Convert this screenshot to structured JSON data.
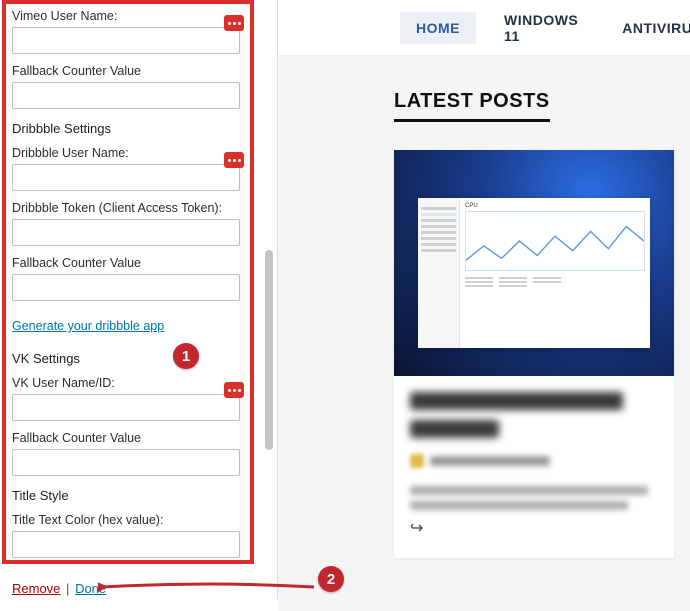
{
  "sidebar": {
    "vimeo": {
      "user_label": "Vimeo User Name:"
    },
    "fallback_label": "Fallback Counter Value",
    "dribbble": {
      "section": "Dribbble Settings",
      "user_label": "Dribbble User Name:",
      "token_label": "Dribbble Token (Client Access Token):",
      "gen_link": "Generate your dribbble app"
    },
    "vk": {
      "section": "VK Settings",
      "user_label": "VK User Name/ID:"
    },
    "title_style": {
      "section": "Title Style",
      "color_label": "Title Text Color (hex value):"
    }
  },
  "actions": {
    "remove": "Remove",
    "separator": "|",
    "done": "Done"
  },
  "preview": {
    "nav": {
      "home": "HOME",
      "win11": "WINDOWS 11",
      "antivirus": "ANTIVIRUS"
    },
    "latest": "LATEST POSTS",
    "taskmgr": {
      "cpu": "CPU"
    },
    "share_glyph": "↪"
  },
  "callouts": {
    "one": "1",
    "two": "2"
  }
}
